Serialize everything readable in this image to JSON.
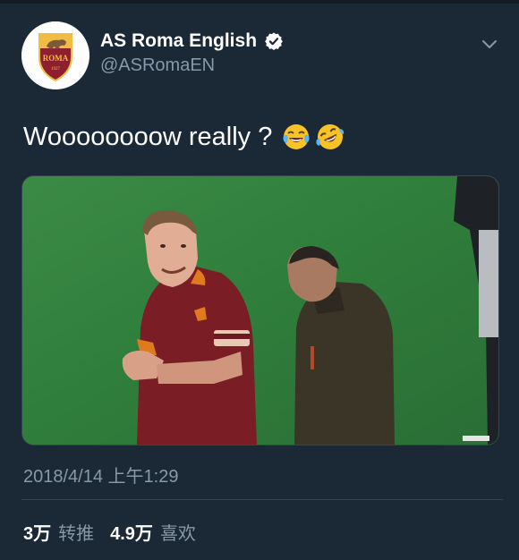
{
  "account": {
    "display_name": "AS Roma English",
    "handle": "@ASRomaEN",
    "avatar_text": "ROMA",
    "avatar_year": "1927",
    "verified_icon": "verified-badge-icon",
    "menu_icon": "chevron-down-icon"
  },
  "tweet": {
    "text": "Woooooooow really ?",
    "emojis": [
      "face-with-tears-of-joy-emoji",
      "rolling-on-floor-laughing-emoji"
    ],
    "timestamp": "2018/4/14 上午1:29"
  },
  "stats": {
    "retweets_count": "3万",
    "retweets_label": "转推",
    "likes_count": "4.9万",
    "likes_label": "喜欢"
  },
  "colors": {
    "background": "#1b2836",
    "secondary_text": "#8899a6",
    "divider": "#38444d",
    "roma_red": "#8e1f2f",
    "roma_gold": "#f0bc42"
  }
}
